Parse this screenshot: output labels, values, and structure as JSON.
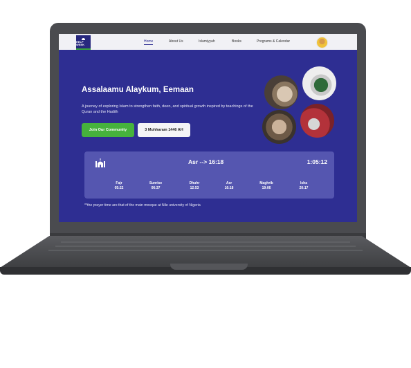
{
  "nav": {
    "logo_text": "HELP WEEK",
    "links": [
      "Home",
      "About Us",
      "Islamiyyah",
      "Books",
      "Programs & Calendar"
    ]
  },
  "hero": {
    "greeting": "Assalaamu Alaykum, Eemaan",
    "subtext": "A journey of exploring Islam to strengthen faith, deen, and spiritual growth inspired by teachings of the Quran and the Hadith",
    "primary_button": "Join Our Community",
    "date_button": "3 Muhharam 1446 AH"
  },
  "prayer": {
    "current": "Asr --> 16:18",
    "countdown": "1:05:12",
    "times": [
      {
        "name": "Fajr",
        "time": "05:22"
      },
      {
        "name": "Sunrise",
        "time": "06:37"
      },
      {
        "name": "Dhuhr",
        "time": "12:53"
      },
      {
        "name": "Asr",
        "time": "16:18"
      },
      {
        "name": "Maghrib",
        "time": "19:06"
      },
      {
        "name": "Isha",
        "time": "20:17"
      }
    ],
    "note": "**the prayer time are that of the main mosque at Nile university of Nigeria"
  },
  "colors": {
    "background": "#2e2e92",
    "accent_green": "#46b23c",
    "card": "#5556b0"
  },
  "icons": [
    "mosque-icon",
    "avatar"
  ]
}
